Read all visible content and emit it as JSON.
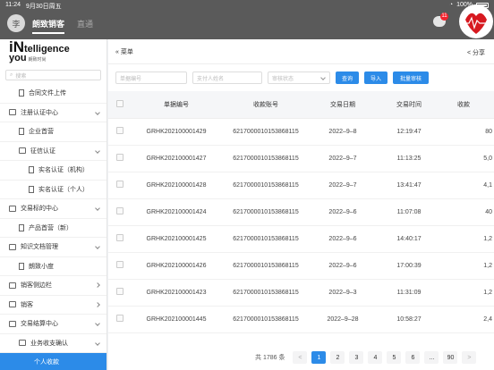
{
  "status_bar": {
    "time": "11:24",
    "date": "9月30日周五",
    "battery": "100%"
  },
  "header": {
    "avatar_text": "李",
    "active_tab": "朗致销客",
    "second_tab": "直通",
    "notification_count": "11",
    "colors": {
      "bar": "#5a5a5a",
      "accent": "#2c8be8"
    }
  },
  "sidebar": {
    "logo_i": "iN",
    "logo_top": "telligence",
    "logo_bottom": "you",
    "logo_cn": "朗致时尚",
    "search_placeholder": "搜索",
    "items": [
      {
        "label": "合同文件上传",
        "type": "doc",
        "indent": 2
      },
      {
        "label": "注册认证中心",
        "type": "folder",
        "indent": 1,
        "expanded": true
      },
      {
        "label": "企业首营",
        "type": "doc",
        "indent": 2
      },
      {
        "label": "征信认证",
        "type": "folder",
        "indent": 2,
        "expanded": true
      },
      {
        "label": "实名认证（机构）",
        "type": "doc",
        "indent": 3
      },
      {
        "label": "实名认证（个人）",
        "type": "doc",
        "indent": 3
      },
      {
        "label": "交易标的中心",
        "type": "folder",
        "indent": 1,
        "expanded": true
      },
      {
        "label": "产品首营（新）",
        "type": "doc",
        "indent": 2
      },
      {
        "label": "知识文档管理",
        "type": "folder",
        "indent": 1,
        "expanded": true
      },
      {
        "label": "朗致小度",
        "type": "doc",
        "indent": 2
      },
      {
        "label": "销客侧边栏",
        "type": "folder",
        "indent": 1,
        "expanded": false
      },
      {
        "label": "销客",
        "type": "folder",
        "indent": 1,
        "expanded": false
      },
      {
        "label": "交易结算中心",
        "type": "folder",
        "indent": 1,
        "expanded": true
      },
      {
        "label": "业务收支确认",
        "type": "folder",
        "indent": 2,
        "expanded": true
      },
      {
        "label": "个人收款",
        "type": "doc",
        "indent": 3,
        "active": true
      }
    ]
  },
  "content": {
    "menu_label": "菜单",
    "share_label": "分享",
    "filters": {
      "order_no_placeholder": "单据编号",
      "payer_placeholder": "支付人姓名",
      "status_placeholder": "审核状态",
      "query_label": "查询",
      "import_label": "导入",
      "batch_audit_label": "批量审核"
    },
    "table": {
      "columns": [
        "单据编号",
        "收款账号",
        "交易日期",
        "交易时间",
        "收款"
      ],
      "rows": [
        [
          "GRHK202100001429",
          "6217000010153868115",
          "2022–9–8",
          "12:19:47",
          "80"
        ],
        [
          "GRHK202100001427",
          "6217000010153868115",
          "2022–9–7",
          "11:13:25",
          "5,0"
        ],
        [
          "GRHK202100001428",
          "6217000010153868115",
          "2022–9–7",
          "13:41:47",
          "4,1"
        ],
        [
          "GRHK202100001424",
          "6217000010153868115",
          "2022–9–6",
          "11:07:08",
          "40"
        ],
        [
          "GRHK202100001425",
          "6217000010153868115",
          "2022–9–6",
          "14:40:17",
          "1,2"
        ],
        [
          "GRHK202100001426",
          "6217000010153868115",
          "2022–9–6",
          "17:00:39",
          "1,2"
        ],
        [
          "GRHK202100001423",
          "6217000010153868115",
          "2022–9–3",
          "11:31:09",
          "1,2"
        ],
        [
          "GRHK202100001445",
          "6217000010153868115",
          "2022–9–28",
          "10:58:27",
          "2,4"
        ]
      ]
    },
    "pagination": {
      "total": "共 1786 条",
      "prev": "<",
      "pages": [
        "1",
        "2",
        "3",
        "4",
        "5",
        "6",
        "...",
        "90"
      ],
      "next": ">",
      "current": "1"
    }
  }
}
